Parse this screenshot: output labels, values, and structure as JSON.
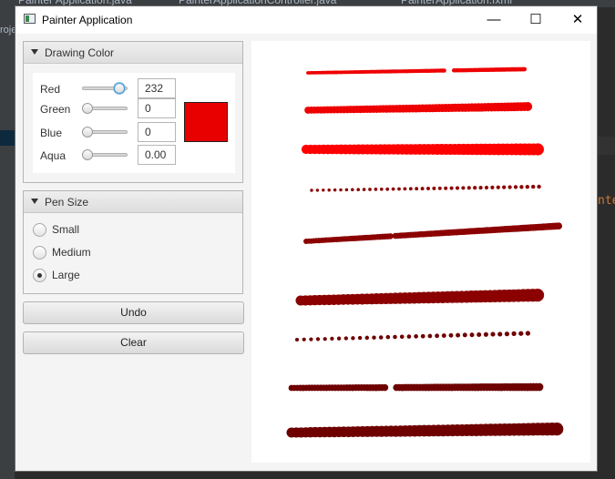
{
  "background": {
    "ide_tabs": [
      "Painter Application.java",
      "PainterApplicationController.java",
      "PainterApplication.fxml"
    ],
    "left_text": "roje",
    "right_text": "nte"
  },
  "window": {
    "title": "Painter Application",
    "controls": {
      "minimize": "—",
      "maximize": "☐",
      "close": "✕"
    }
  },
  "drawing_color": {
    "title": "Drawing Color",
    "rows": [
      {
        "label": "Red",
        "value": "232",
        "fraction": 0.91
      },
      {
        "label": "Green",
        "value": "0",
        "fraction": 0.0
      },
      {
        "label": "Blue",
        "value": "0",
        "fraction": 0.0
      },
      {
        "label": "Aqua",
        "value": "0.00",
        "fraction": 0.0
      }
    ],
    "swatch_color": "#e80000"
  },
  "pen_size": {
    "title": "Pen Size",
    "options": [
      {
        "label": "Small",
        "selected": false
      },
      {
        "label": "Medium",
        "selected": false
      },
      {
        "label": "Large",
        "selected": true
      }
    ]
  },
  "buttons": {
    "undo": "Undo",
    "clear": "Clear"
  },
  "strokes": [
    {
      "color": "#ee0000",
      "style": "thin-solid"
    },
    {
      "color": "#ee0000",
      "style": "medium-solid"
    },
    {
      "color": "#ff0000",
      "style": "large-solid"
    },
    {
      "color": "#8b0000",
      "style": "small-dotted"
    },
    {
      "color": "#8b0000",
      "style": "medium-dotted"
    },
    {
      "color": "#8b0000",
      "style": "large-solid"
    },
    {
      "color": "#6e0000",
      "style": "small-dotted"
    },
    {
      "color": "#6e0000",
      "style": "medium-solid"
    },
    {
      "color": "#6e0000",
      "style": "large-solid"
    }
  ]
}
